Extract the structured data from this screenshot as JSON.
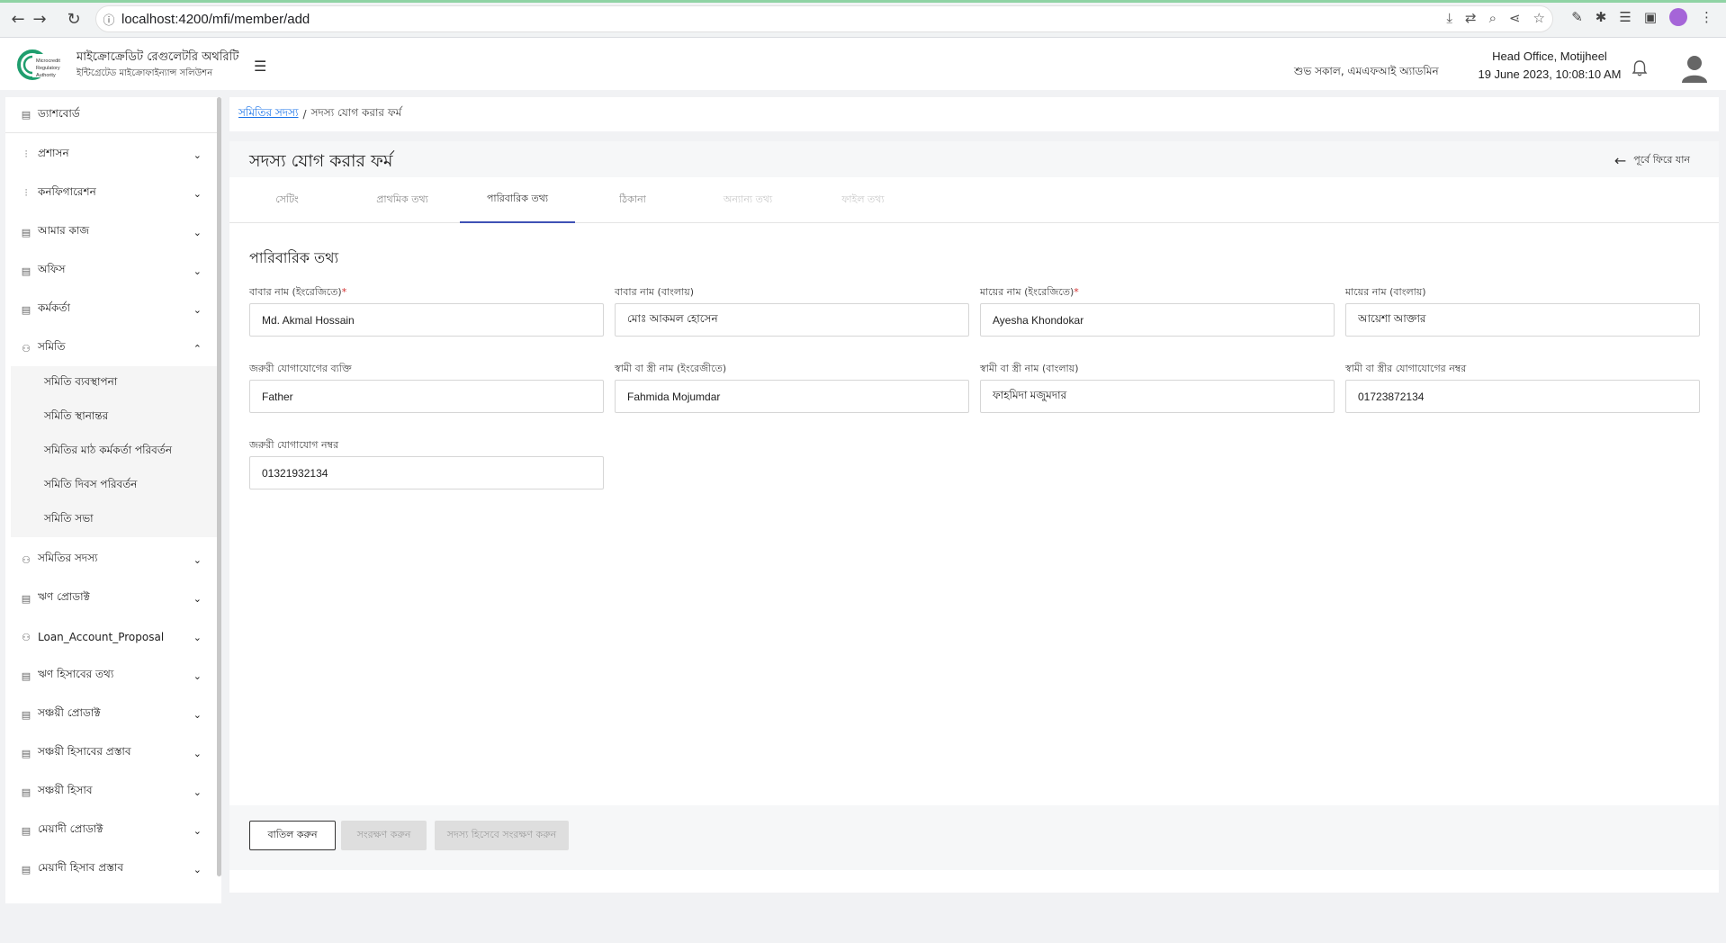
{
  "browser": {
    "url": "localhost:4200/mfi/member/add"
  },
  "header": {
    "brand_title": "মাইক্রোক্রেডিট রেগুলেটরি অথরিটি",
    "brand_subtitle": "ইন্টিগ্রেটেড মাইক্রোফাইন্যান্স সলিউশন",
    "logo_text": "Microcredit Regulatory Authority",
    "greeting": "শুভ সকাল, এমএফআই অ্যাডমিন",
    "office": "Head Office, Motijheel",
    "datetime": "19 June 2023, 10:08:10 AM"
  },
  "sidebar": {
    "dashboard": "ড্যাশবোর্ড",
    "items": [
      {
        "label": "প্রশাসন",
        "icon": "sliders-icon"
      },
      {
        "label": "কনফিগারেশন",
        "icon": "sliders-icon"
      },
      {
        "label": "আমার কাজ",
        "icon": "doc-icon"
      },
      {
        "label": "অফিস",
        "icon": "doc-icon"
      },
      {
        "label": "কর্মকর্তা",
        "icon": "doc-icon"
      },
      {
        "label": "সমিতি",
        "icon": "group-icon",
        "expanded": true
      }
    ],
    "submenu": [
      "সমিতি ব্যবস্থাপনা",
      "সমিতি স্থানান্তর",
      "সমিতির মাঠ কর্মকর্তা পরিবর্তন",
      "সমিতি দিবস পরিবর্তন",
      "সমিতি সভা"
    ],
    "items_after": [
      {
        "label": "সমিতির সদস্য",
        "icon": "group-icon"
      },
      {
        "label": "ঋণ প্রোডাক্ট",
        "icon": "doc-icon"
      },
      {
        "label": "Loan_Account_Proposal",
        "icon": "group-icon"
      },
      {
        "label": "ঋণ হিসাবের তথ্য",
        "icon": "doc-icon"
      },
      {
        "label": "সঞ্চয়ী প্রোডাক্ট",
        "icon": "doc-icon"
      },
      {
        "label": "সঞ্চয়ী হিসাবের প্রস্তাব",
        "icon": "doc-icon"
      },
      {
        "label": "সঞ্চয়ী হিসাব",
        "icon": "doc-icon"
      },
      {
        "label": "মেয়াদী প্রোডাক্ট",
        "icon": "doc-icon"
      },
      {
        "label": "মেয়াদী হিসাব প্রস্তাব",
        "icon": "doc-icon"
      }
    ]
  },
  "breadcrumb": {
    "parent": "সমিতির সদস্য",
    "separator": "/",
    "current": "সদস্য যোগ করার ফর্ম"
  },
  "page": {
    "title": "সদস্য যোগ করার ফর্ম",
    "back_label": "পূর্বে ফিরে যান"
  },
  "tabs": [
    {
      "label": "সেটিং",
      "state": "normal"
    },
    {
      "label": "প্রাথমিক তথ্য",
      "state": "normal"
    },
    {
      "label": "পারিবারিক তথ্য",
      "state": "active"
    },
    {
      "label": "ঠিকানা",
      "state": "normal"
    },
    {
      "label": "অন্যান্য তথ্য",
      "state": "disabled"
    },
    {
      "label": "ফাইল তথ্য",
      "state": "disabled"
    }
  ],
  "form": {
    "section_title": "পারিবারিক তথ্য",
    "required_mark": "*",
    "fields": [
      {
        "label": "বাবার নাম (ইংরেজিতে)",
        "required": true,
        "value": "Md. Akmal Hossain"
      },
      {
        "label": "বাবার নাম (বাংলায়)",
        "required": false,
        "value": "মোঃ আকমল হোসেন"
      },
      {
        "label": "মায়ের নাম (ইংরেজিতে)",
        "required": true,
        "value": "Ayesha Khondokar"
      },
      {
        "label": "মায়ের নাম (বাংলায়)",
        "required": false,
        "value": "আয়েশা আক্তার"
      },
      {
        "label": "জরুরী যোগাযোগের ব্যক্তি",
        "required": false,
        "value": "Father"
      },
      {
        "label": "স্বামী বা স্ত্রী নাম (ইংরেজীতে)",
        "required": false,
        "value": "Fahmida Mojumdar"
      },
      {
        "label": "স্বামী বা স্ত্রী নাম (বাংলায়)",
        "required": false,
        "value": "ফাহমিদা মজুমদার"
      },
      {
        "label": "স্বামী বা স্ত্রীর যোগাযোগের নম্বর",
        "required": false,
        "value": "01723872134"
      },
      {
        "label": "জরুরী যোগাযোগ নম্বর",
        "required": false,
        "value": "01321932134"
      }
    ]
  },
  "actions": {
    "cancel": "বাতিল করুন",
    "save": "সংরক্ষণ করুন",
    "save_as_member": "সদস্য হিসেবে সংরক্ষণ করুন"
  },
  "colors": {
    "accent": "#3f51b5",
    "link": "#1a73e8",
    "required": "#d32f2f",
    "logo_green": "#1f9e6e"
  }
}
